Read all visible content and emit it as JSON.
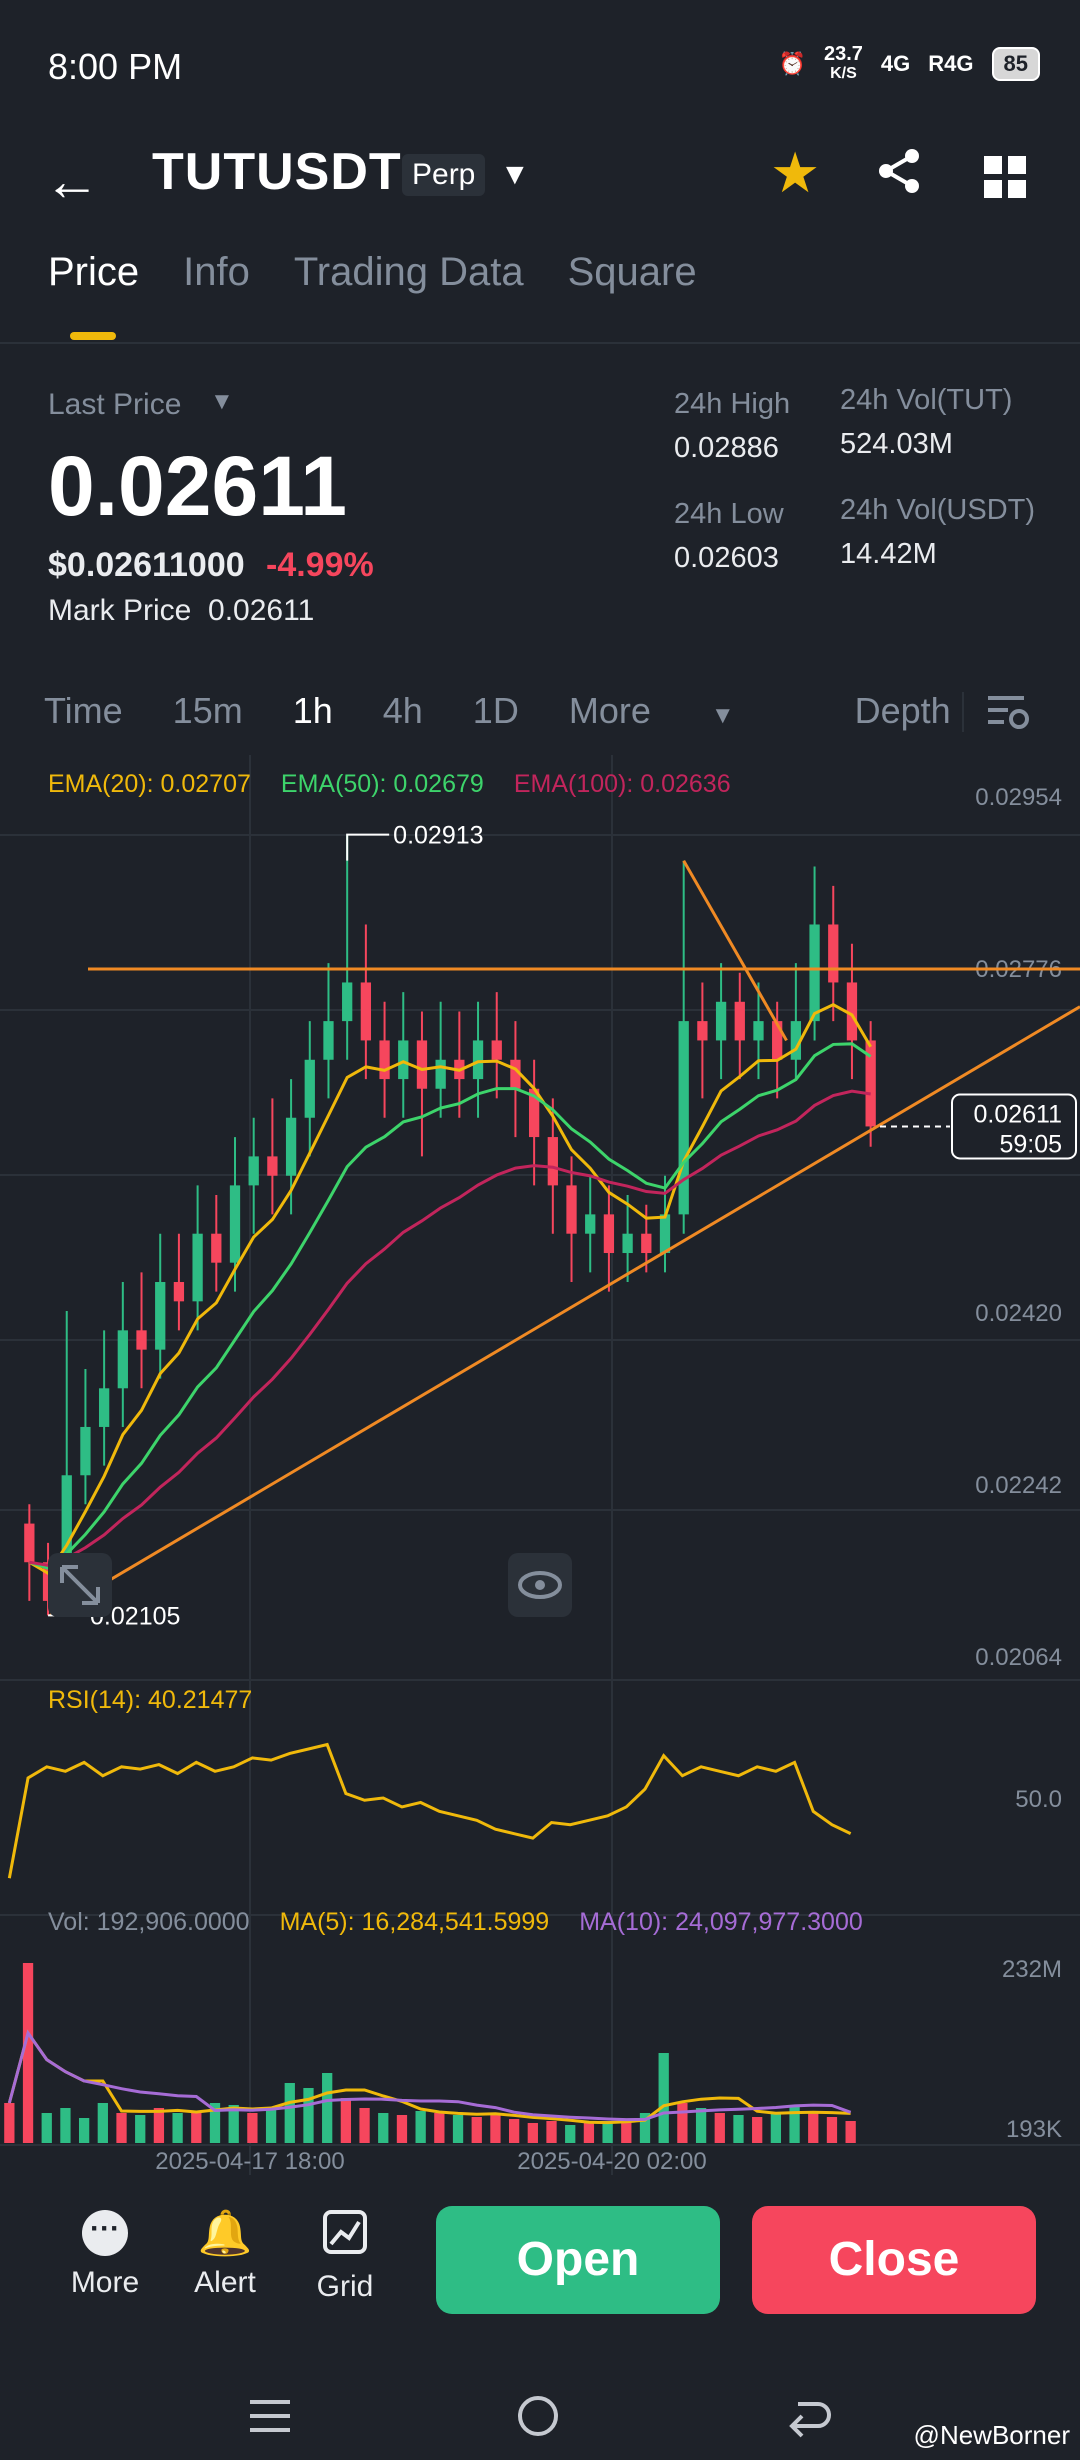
{
  "status": {
    "time": "8:00 PM",
    "speed": "23.7",
    "speed_unit": "K/S",
    "net1": "4G",
    "net2": "R4G",
    "battery": "85"
  },
  "header": {
    "symbol": "TUTUSDT",
    "badge": "Perp"
  },
  "tabs": [
    {
      "label": "Price"
    },
    {
      "label": "Info"
    },
    {
      "label": "Trading Data"
    },
    {
      "label": "Square"
    }
  ],
  "price": {
    "last_label": "Last Price",
    "last": "0.02611",
    "usd": "$0.02611000",
    "change": "-4.99%",
    "mark_label": "Mark Price",
    "mark": "0.02611",
    "high_label": "24h High",
    "high": "0.02886",
    "low_label": "24h Low",
    "low": "0.02603",
    "vol_tut_label": "24h Vol(TUT)",
    "vol_tut": "524.03M",
    "vol_usdt_label": "24h Vol(USDT)",
    "vol_usdt": "14.42M"
  },
  "timeframes": {
    "items": [
      "Time",
      "15m",
      "1h",
      "4h",
      "1D"
    ],
    "active": "1h",
    "more": "More",
    "depth": "Depth"
  },
  "colors": {
    "up": "#2ebd85",
    "down": "#f6465d",
    "accent": "#f0b90b",
    "ema20": "#f0b90b",
    "ema50": "#3dd46b",
    "ema100": "#c2255c",
    "line": "#f08a24",
    "ma10": "#a66cd6"
  },
  "indicators": {
    "ema20": "EMA(20): 0.02707",
    "ema50": "EMA(50): 0.02679",
    "ema100": "EMA(100): 0.02636",
    "rsi": "RSI(14): 40.21477",
    "vol": "Vol: 192,906.0000",
    "ma5": "MA(5): 16,284,541.5999",
    "ma10": "MA(10): 24,097,977.3000"
  },
  "chart_data": {
    "type": "candlestick",
    "y_axis_ticks": [
      "0.02954",
      "0.02776",
      "0.02420",
      "0.02242",
      "0.02064"
    ],
    "ylim": [
      0.02064,
      0.02954
    ],
    "high_marker": "0.02913",
    "low_marker": "0.02105",
    "current_price": "0.02611",
    "countdown": "59:05",
    "rsi_level": "50.0",
    "vol_ticks": [
      "232M",
      "193K"
    ],
    "x_labels": [
      "2025-04-17 18:00",
      "2025-04-20 02:00"
    ],
    "candles": [
      {
        "o": 0.022,
        "c": 0.0216,
        "h": 0.0222,
        "l": 0.0212
      },
      {
        "o": 0.0216,
        "c": 0.0212,
        "h": 0.0218,
        "l": 0.02105
      },
      {
        "o": 0.0212,
        "c": 0.0225,
        "h": 0.0242,
        "l": 0.0211
      },
      {
        "o": 0.0225,
        "c": 0.023,
        "h": 0.0236,
        "l": 0.0222
      },
      {
        "o": 0.023,
        "c": 0.0234,
        "h": 0.024,
        "l": 0.0226
      },
      {
        "o": 0.0234,
        "c": 0.024,
        "h": 0.0245,
        "l": 0.023
      },
      {
        "o": 0.024,
        "c": 0.0238,
        "h": 0.0246,
        "l": 0.0234
      },
      {
        "o": 0.0238,
        "c": 0.0245,
        "h": 0.025,
        "l": 0.0235
      },
      {
        "o": 0.0245,
        "c": 0.0243,
        "h": 0.025,
        "l": 0.024
      },
      {
        "o": 0.0243,
        "c": 0.025,
        "h": 0.0255,
        "l": 0.024
      },
      {
        "o": 0.025,
        "c": 0.0247,
        "h": 0.0254,
        "l": 0.0244
      },
      {
        "o": 0.0247,
        "c": 0.0255,
        "h": 0.026,
        "l": 0.0244
      },
      {
        "o": 0.0255,
        "c": 0.0258,
        "h": 0.0262,
        "l": 0.025
      },
      {
        "o": 0.0258,
        "c": 0.0256,
        "h": 0.0264,
        "l": 0.0252
      },
      {
        "o": 0.0256,
        "c": 0.0262,
        "h": 0.0266,
        "l": 0.0252
      },
      {
        "o": 0.0262,
        "c": 0.0268,
        "h": 0.0272,
        "l": 0.0258
      },
      {
        "o": 0.0268,
        "c": 0.0272,
        "h": 0.0278,
        "l": 0.0264
      },
      {
        "o": 0.0272,
        "c": 0.0276,
        "h": 0.02913,
        "l": 0.0268
      },
      {
        "o": 0.0276,
        "c": 0.027,
        "h": 0.0282,
        "l": 0.0266
      },
      {
        "o": 0.027,
        "c": 0.0266,
        "h": 0.0274,
        "l": 0.0262
      },
      {
        "o": 0.0266,
        "c": 0.027,
        "h": 0.0275,
        "l": 0.0262
      },
      {
        "o": 0.027,
        "c": 0.0265,
        "h": 0.0273,
        "l": 0.0258
      },
      {
        "o": 0.0265,
        "c": 0.0268,
        "h": 0.0274,
        "l": 0.0262
      },
      {
        "o": 0.0268,
        "c": 0.0266,
        "h": 0.0273,
        "l": 0.0262
      },
      {
        "o": 0.0266,
        "c": 0.027,
        "h": 0.0274,
        "l": 0.0262
      },
      {
        "o": 0.027,
        "c": 0.0268,
        "h": 0.0275,
        "l": 0.0264
      },
      {
        "o": 0.0268,
        "c": 0.0265,
        "h": 0.0272,
        "l": 0.026
      },
      {
        "o": 0.0265,
        "c": 0.026,
        "h": 0.0268,
        "l": 0.0255
      },
      {
        "o": 0.026,
        "c": 0.0255,
        "h": 0.0264,
        "l": 0.025
      },
      {
        "o": 0.0255,
        "c": 0.025,
        "h": 0.0258,
        "l": 0.0245
      },
      {
        "o": 0.025,
        "c": 0.0252,
        "h": 0.0256,
        "l": 0.0246
      },
      {
        "o": 0.0252,
        "c": 0.0248,
        "h": 0.0255,
        "l": 0.0244
      },
      {
        "o": 0.0248,
        "c": 0.025,
        "h": 0.0254,
        "l": 0.0245
      },
      {
        "o": 0.025,
        "c": 0.0248,
        "h": 0.0253,
        "l": 0.0246
      },
      {
        "o": 0.0248,
        "c": 0.0252,
        "h": 0.0256,
        "l": 0.0246
      },
      {
        "o": 0.0252,
        "c": 0.0272,
        "h": 0.02886,
        "l": 0.025
      },
      {
        "o": 0.0272,
        "c": 0.027,
        "h": 0.0276,
        "l": 0.0264
      },
      {
        "o": 0.027,
        "c": 0.0274,
        "h": 0.0278,
        "l": 0.0266
      },
      {
        "o": 0.0274,
        "c": 0.027,
        "h": 0.0277,
        "l": 0.0266
      },
      {
        "o": 0.027,
        "c": 0.0272,
        "h": 0.0276,
        "l": 0.0266
      },
      {
        "o": 0.0272,
        "c": 0.0268,
        "h": 0.0274,
        "l": 0.0264
      },
      {
        "o": 0.0268,
        "c": 0.0272,
        "h": 0.0278,
        "l": 0.0266
      },
      {
        "o": 0.0272,
        "c": 0.0282,
        "h": 0.0288,
        "l": 0.027
      },
      {
        "o": 0.0282,
        "c": 0.0276,
        "h": 0.0286,
        "l": 0.0272
      },
      {
        "o": 0.0276,
        "c": 0.027,
        "h": 0.028,
        "l": 0.0266
      },
      {
        "o": 0.027,
        "c": 0.02611,
        "h": 0.0272,
        "l": 0.0259
      }
    ]
  },
  "bottom": {
    "more": "More",
    "alert": "Alert",
    "grid": "Grid",
    "open": "Open",
    "close": "Close"
  },
  "watermark": "@NewBorner"
}
